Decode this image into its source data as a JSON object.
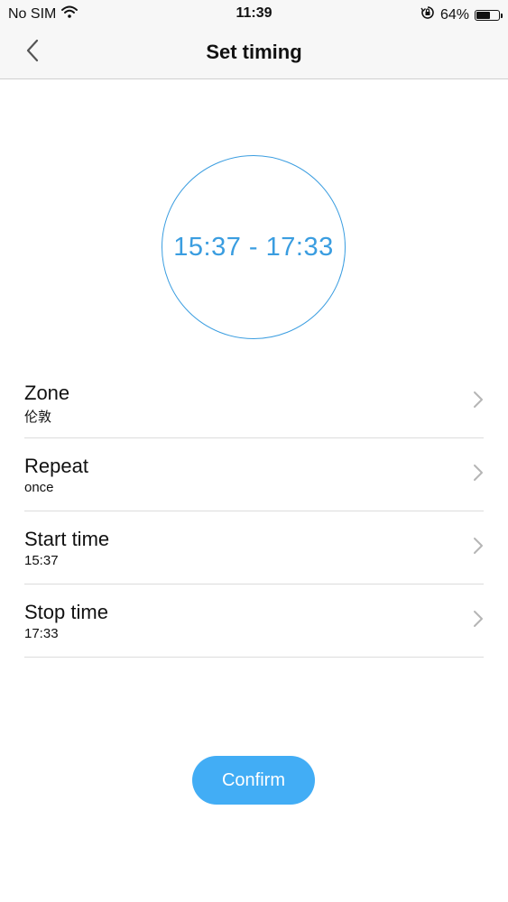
{
  "status_bar": {
    "carrier": "No SIM",
    "time": "11:39",
    "battery_percent": "64%",
    "battery_level": 0.64,
    "icons": [
      "wifi-icon",
      "orientation-lock-icon",
      "battery-icon"
    ]
  },
  "nav": {
    "title": "Set timing",
    "back_icon": "chevron-left-icon"
  },
  "timer": {
    "range": "15:37 - 17:33",
    "accent_color": "#3a9de0"
  },
  "settings": [
    {
      "title": "Zone",
      "value": "伦敦"
    },
    {
      "title": "Repeat",
      "value": "once"
    },
    {
      "title": "Start time",
      "value": "15:37"
    },
    {
      "title": "Stop time",
      "value": "17:33"
    }
  ],
  "confirm": {
    "label": "Confirm",
    "color": "#42adf5"
  }
}
